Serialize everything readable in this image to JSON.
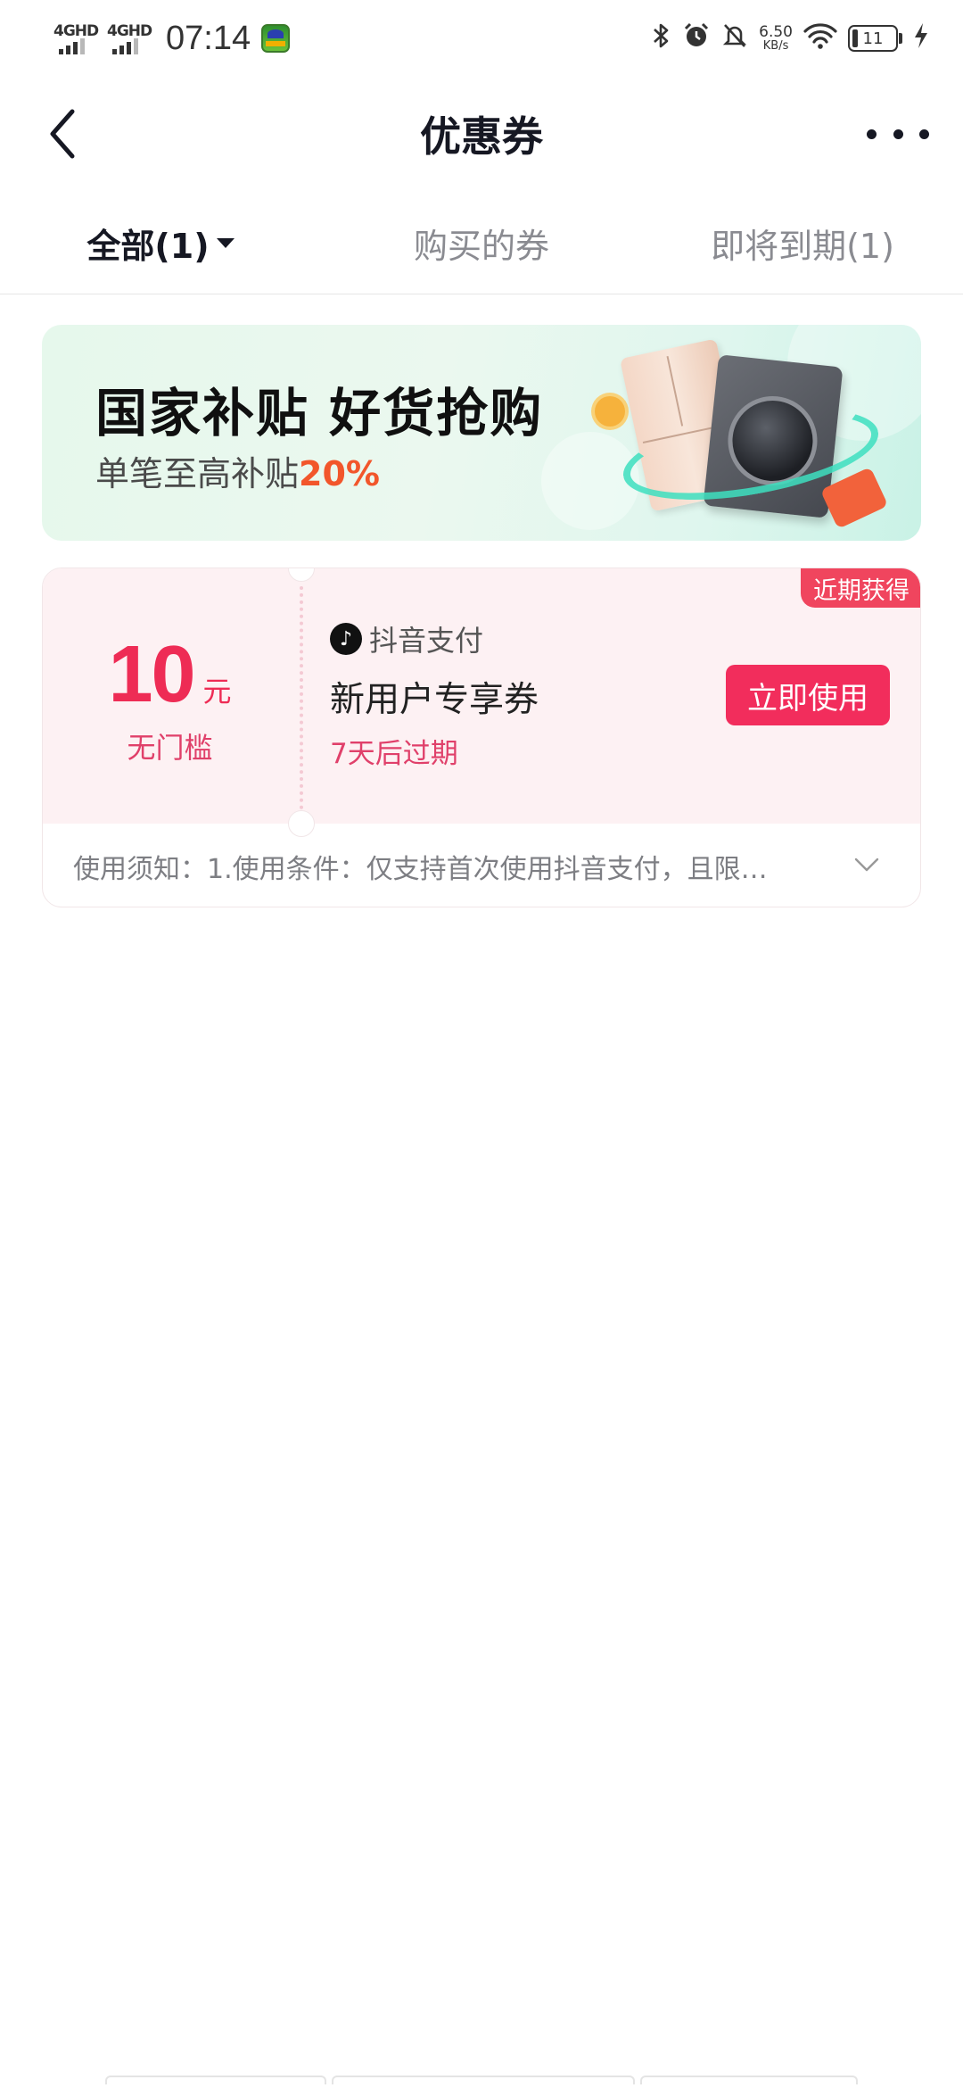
{
  "status_bar": {
    "network1": "4GHD",
    "network2": "4GHD",
    "time": "07:14",
    "speed_value": "6.50",
    "speed_unit": "KB/s",
    "battery": "11",
    "icons": [
      "bluetooth-icon",
      "alarm-icon",
      "mute-icon",
      "wifi-icon",
      "charging-icon"
    ]
  },
  "header": {
    "title": "优惠券"
  },
  "tabs": [
    {
      "label": "全部(1)",
      "active": true
    },
    {
      "label": "购买的券",
      "active": false
    },
    {
      "label": "即将到期(1)",
      "active": false
    }
  ],
  "banner": {
    "title": "国家补贴 好货抢购",
    "subtitle_prefix": "单笔至高补贴",
    "subtitle_highlight": "20%"
  },
  "coupon": {
    "badge": "近期获得",
    "amount": "10",
    "unit": "元",
    "threshold": "无门槛",
    "provider": "抖音支付",
    "name": "新用户专享券",
    "expiry": "7天后过期",
    "button": "立即使用",
    "notice": "使用须知：1.使用条件：仅支持首次使用抖音支付，且限…"
  },
  "colors": {
    "accent": "#f22d5c",
    "coupon_bg": "#fdf1f3",
    "banner_highlight": "#f2562b"
  }
}
